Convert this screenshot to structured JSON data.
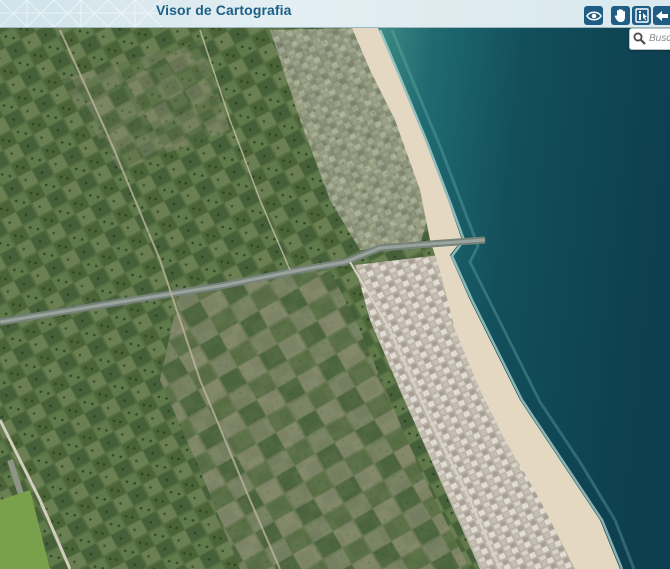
{
  "header": {
    "title": "Visor de Cartografia"
  },
  "toolbar": {
    "tools": [
      {
        "name": "visibility",
        "icon": "eye-icon"
      },
      {
        "name": "pan",
        "icon": "hand-icon"
      },
      {
        "name": "identify",
        "icon": "info-pointer-icon"
      },
      {
        "name": "back",
        "icon": "arrow-left-icon"
      }
    ]
  },
  "search": {
    "placeholder": "Buscar"
  },
  "map": {
    "type": "orthophoto",
    "description_colors": {
      "sea_deep": "#0f4a57",
      "sea_shallow": "#3d8a86",
      "beach": "#e3d6bf",
      "fields": "#4f6b3e",
      "urban": "#c9c3b8"
    }
  },
  "colors": {
    "brand": "#1f5d84",
    "header_bg": "#dcebf0"
  }
}
